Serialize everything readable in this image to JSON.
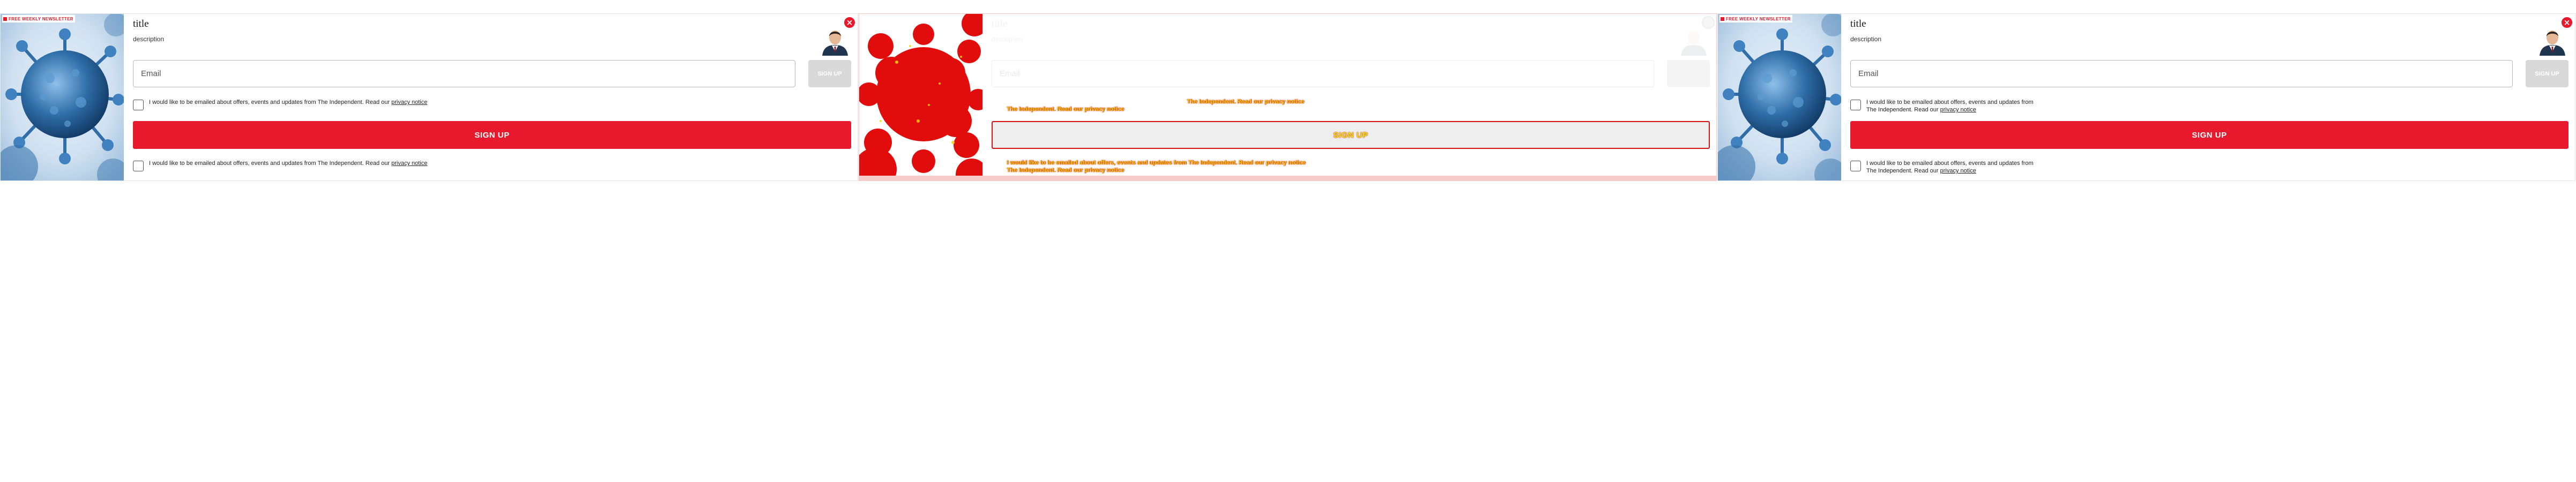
{
  "panels": {
    "reference": {
      "badge": "FREE WEEKLY NEWSLETTER",
      "title": "title",
      "description": "description",
      "email_placeholder": "Email",
      "signup_small_label": "SIGN UP",
      "signup_main_label": "SIGN UP",
      "consent_text": "I would like to be emailed about offers, events and updates from The Independent. Read our ",
      "privacy_link": "privacy notice",
      "close_symbol": "×"
    },
    "diff": {
      "title": "title",
      "description": "description",
      "email_placeholder": "Email",
      "signup_small_label": "SIGN UP",
      "signup_main_label": "SIGN UP",
      "consent_text": "I would like to be emailed about offers, events and updates from The Independent. Read our ",
      "privacy_link": "privacy notice",
      "shifted_line_1": "The Independent. Read our privacy notice",
      "shifted_line_2": "The Independent. Read our privacy notice",
      "close_symbol": "×"
    },
    "candidate": {
      "badge": "FREE WEEKLY NEWSLETTER",
      "title": "title",
      "description": "description",
      "email_placeholder": "Email",
      "signup_small_label": "SIGN UP",
      "signup_main_label": "SIGN UP",
      "consent_text": "I would like to be emailed about offers, events and updates from The Independent. Read our ",
      "privacy_link": "privacy notice",
      "close_symbol": "×"
    }
  },
  "colors": {
    "brand_red": "#e8192c",
    "disabled_button": "#d9d9d9",
    "diff_red": "#d21414",
    "diff_yellow": "#f1d300",
    "virus_blue": "#2f6ea8"
  },
  "icons": {
    "close": "close-icon",
    "avatar": "author-avatar",
    "image": "coronavirus-image"
  }
}
